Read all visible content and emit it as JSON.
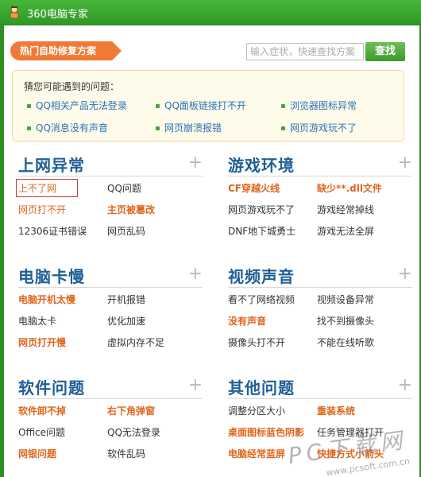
{
  "window": {
    "title": "360电脑专家"
  },
  "hot_tag": "热门自助修复方案",
  "search": {
    "placeholder": "输入症状，快速查找方案",
    "button": "查找"
  },
  "suggest": {
    "title": "猜您可能遇到的问题：",
    "items": [
      "QQ相关产品无法登录",
      "QQ面板链接打不开",
      "浏览器图标异常",
      "QQ消息没有声音",
      "网页崩溃报错",
      "网页游戏玩不了"
    ]
  },
  "sections": [
    {
      "name": "上网异常",
      "rows": [
        [
          {
            "text": "上不了网",
            "style": "hot",
            "selected": true
          },
          {
            "text": "QQ问题",
            "style": "norm"
          }
        ],
        [
          {
            "text": "网页打不开",
            "style": "hot"
          },
          {
            "text": "主页被篡改",
            "style": "hot"
          }
        ],
        [
          {
            "text": "12306证书错误",
            "style": "norm"
          },
          {
            "text": "网页乱码",
            "style": "norm"
          }
        ]
      ]
    },
    {
      "name": "游戏环境",
      "rows": [
        [
          {
            "text": "CF穿越火线",
            "style": "hot"
          },
          {
            "text": "缺少**.dll文件",
            "style": "hot"
          }
        ],
        [
          {
            "text": "网页游戏玩不了",
            "style": "norm"
          },
          {
            "text": "游戏经常掉线",
            "style": "norm"
          }
        ],
        [
          {
            "text": "DNF地下城勇士",
            "style": "norm"
          },
          {
            "text": "游戏无法全屏",
            "style": "norm"
          }
        ]
      ]
    },
    {
      "name": "电脑卡慢",
      "rows": [
        [
          {
            "text": "电脑开机太慢",
            "style": "hot"
          },
          {
            "text": "开机报错",
            "style": "norm"
          }
        ],
        [
          {
            "text": "电脑太卡",
            "style": "norm"
          },
          {
            "text": "优化加速",
            "style": "norm"
          }
        ],
        [
          {
            "text": "网页打开慢",
            "style": "hot"
          },
          {
            "text": "虚拟内存不足",
            "style": "norm"
          }
        ]
      ]
    },
    {
      "name": "视频声音",
      "rows": [
        [
          {
            "text": "看不了网络视频",
            "style": "norm"
          },
          {
            "text": "视频设备异常",
            "style": "norm"
          }
        ],
        [
          {
            "text": "没有声音",
            "style": "hot"
          },
          {
            "text": "找不到摄像头",
            "style": "norm"
          }
        ],
        [
          {
            "text": "摄像头打不开",
            "style": "norm"
          },
          {
            "text": "不能在线听歌",
            "style": "norm"
          }
        ]
      ]
    },
    {
      "name": "软件问题",
      "rows": [
        [
          {
            "text": "软件卸不掉",
            "style": "hot"
          },
          {
            "text": "右下角弹窗",
            "style": "hot"
          }
        ],
        [
          {
            "text": "Office问题",
            "style": "norm"
          },
          {
            "text": "QQ无法登录",
            "style": "norm"
          }
        ],
        [
          {
            "text": "网银问题",
            "style": "hot"
          },
          {
            "text": "软件乱码",
            "style": "norm"
          }
        ]
      ]
    },
    {
      "name": "其他问题",
      "rows": [
        [
          {
            "text": "调整分区大小",
            "style": "norm"
          },
          {
            "text": "重装系统",
            "style": "hot"
          }
        ],
        [
          {
            "text": "桌面图标蓝色阴影",
            "style": "hot"
          },
          {
            "text": "任务管理器打开",
            "style": "norm"
          }
        ],
        [
          {
            "text": "电脑经常蓝屏",
            "style": "hot"
          },
          {
            "text": "快捷方式小箭头",
            "style": "hot"
          }
        ]
      ]
    }
  ],
  "plus_glyph": "+",
  "watermark": {
    "main": "PC下载网",
    "sub": "www.pcsoft.com.cn"
  }
}
